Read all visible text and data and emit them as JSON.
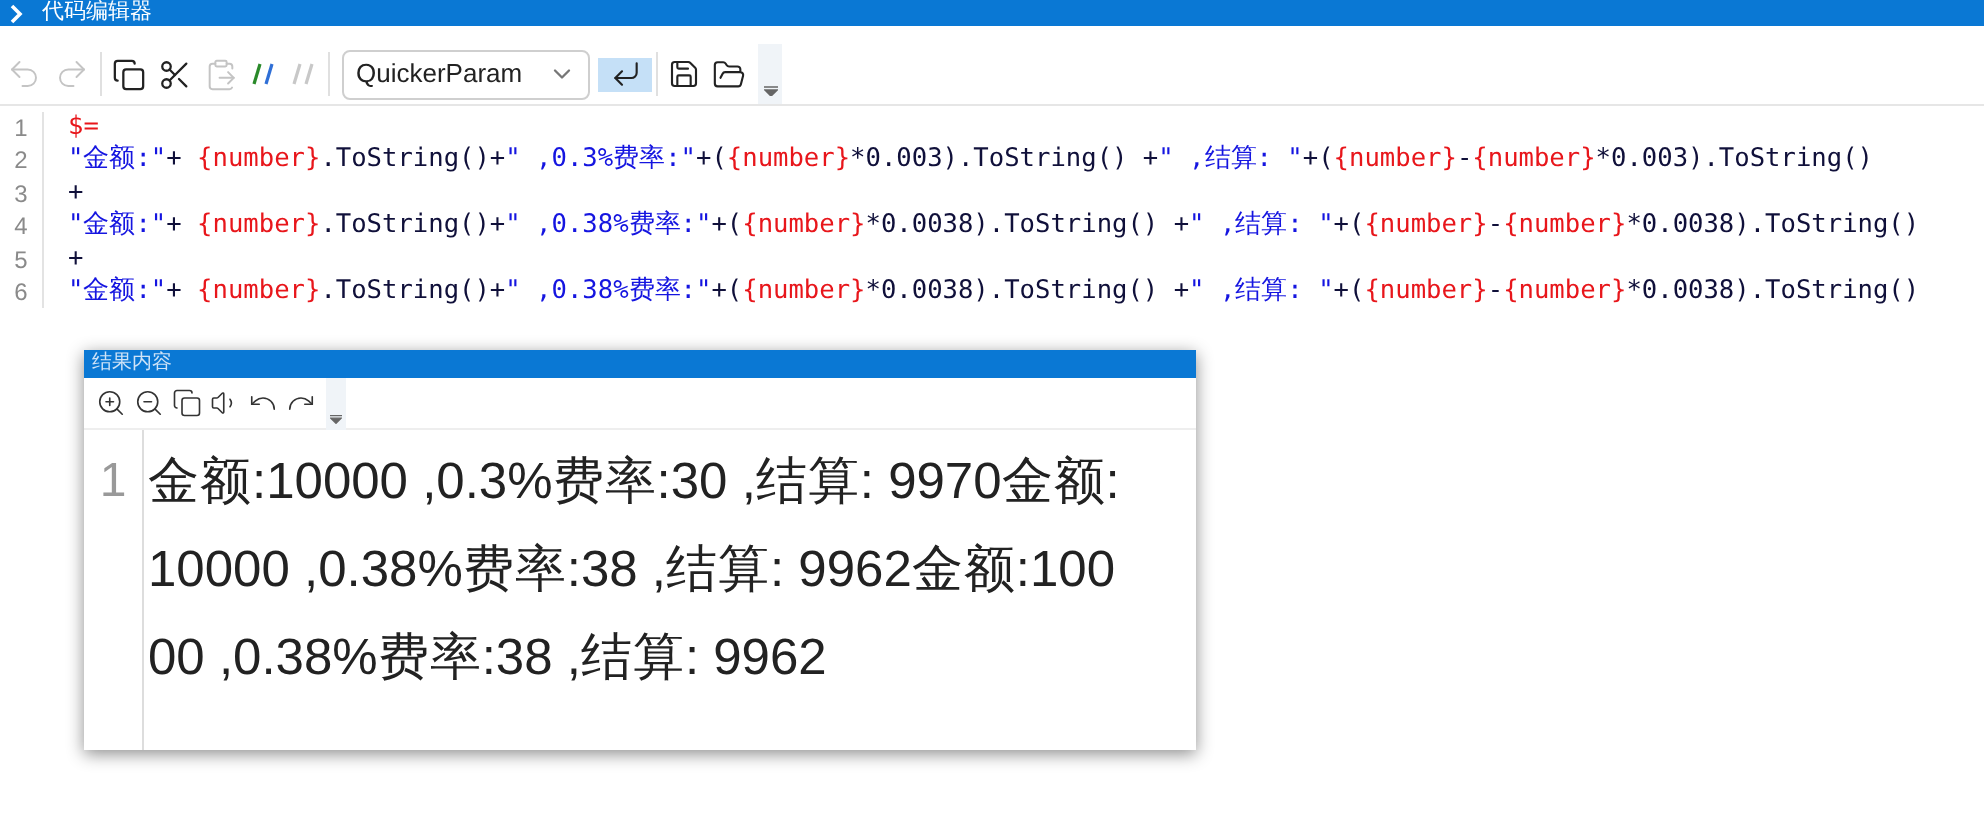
{
  "window": {
    "title": "代码编辑器"
  },
  "toolbar": [
    {
      "kind": "undo",
      "disabled": true
    },
    {
      "kind": "redo",
      "disabled": true
    },
    {
      "kind": "copy",
      "disabled": false
    },
    {
      "kind": "cut",
      "disabled": false
    },
    {
      "kind": "paste",
      "disabled": true
    },
    {
      "kind": "comment",
      "disabled": false
    },
    {
      "kind": "uncomment",
      "disabled": true
    },
    {
      "kind": "select",
      "value": "QuickerParam"
    },
    {
      "kind": "wrap",
      "selected": true
    },
    {
      "kind": "save",
      "disabled": false
    },
    {
      "kind": "open",
      "disabled": false
    }
  ],
  "code_lines": [
    {
      "number": "1",
      "segments": [
        {
          "kind": "var",
          "text": "$="
        }
      ]
    },
    {
      "number": "2",
      "segments": [
        {
          "kind": "string",
          "text": "\"金额:\""
        },
        {
          "kind": "plain",
          "text": "+ "
        },
        {
          "kind": "var",
          "text": "{number}"
        },
        {
          "kind": "plain",
          "text": ".ToString()+"
        },
        {
          "kind": "string",
          "text": "\" ,0.3%费率:\""
        },
        {
          "kind": "plain",
          "text": "+("
        },
        {
          "kind": "var",
          "text": "{number}"
        },
        {
          "kind": "plain",
          "text": "*0.003).ToString() +"
        },
        {
          "kind": "string",
          "text": "\" ,结算: \""
        },
        {
          "kind": "plain",
          "text": "+("
        },
        {
          "kind": "var",
          "text": "{number}"
        },
        {
          "kind": "plain",
          "text": "-"
        },
        {
          "kind": "var",
          "text": "{number}"
        },
        {
          "kind": "plain",
          "text": "*0.003).ToString()"
        }
      ]
    },
    {
      "number": "3",
      "segments": [
        {
          "kind": "plain",
          "text": "+"
        }
      ]
    },
    {
      "number": "4",
      "segments": [
        {
          "kind": "string",
          "text": "\"金额:\""
        },
        {
          "kind": "plain",
          "text": "+ "
        },
        {
          "kind": "var",
          "text": "{number}"
        },
        {
          "kind": "plain",
          "text": ".ToString()+"
        },
        {
          "kind": "string",
          "text": "\" ,0.38%费率:\""
        },
        {
          "kind": "plain",
          "text": "+("
        },
        {
          "kind": "var",
          "text": "{number}"
        },
        {
          "kind": "plain",
          "text": "*0.0038).ToString() +"
        },
        {
          "kind": "string",
          "text": "\" ,结算: \""
        },
        {
          "kind": "plain",
          "text": "+("
        },
        {
          "kind": "var",
          "text": "{number}"
        },
        {
          "kind": "plain",
          "text": "-"
        },
        {
          "kind": "var",
          "text": "{number}"
        },
        {
          "kind": "plain",
          "text": "*0.0038).ToString()"
        }
      ]
    },
    {
      "number": "5",
      "segments": [
        {
          "kind": "plain",
          "text": "+"
        }
      ]
    },
    {
      "number": "6",
      "segments": [
        {
          "kind": "string",
          "text": "\"金额:\""
        },
        {
          "kind": "plain",
          "text": "+ "
        },
        {
          "kind": "var",
          "text": "{number}"
        },
        {
          "kind": "plain",
          "text": ".ToString()+"
        },
        {
          "kind": "string",
          "text": "\" ,0.38%费率:\""
        },
        {
          "kind": "plain",
          "text": "+("
        },
        {
          "kind": "var",
          "text": "{number}"
        },
        {
          "kind": "plain",
          "text": "*0.0038).ToString() +"
        },
        {
          "kind": "string",
          "text": "\" ,结算: \""
        },
        {
          "kind": "plain",
          "text": "+("
        },
        {
          "kind": "var",
          "text": "{number}"
        },
        {
          "kind": "plain",
          "text": "-"
        },
        {
          "kind": "var",
          "text": "{number}"
        },
        {
          "kind": "plain",
          "text": "*0.0038).ToString()"
        }
      ]
    }
  ],
  "result_window": {
    "title": "结果内容",
    "toolbar": [
      {
        "kind": "zoom-in"
      },
      {
        "kind": "zoom-out"
      },
      {
        "kind": "copy"
      },
      {
        "kind": "speak"
      },
      {
        "kind": "undo"
      },
      {
        "kind": "redo"
      }
    ],
    "line_number": "1",
    "text": "金额:10000 ,0.3%费率:30 ,结算: 9970金额:10000 ,0.38%费率:38 ,结算: 9962金额:10000 ,0.38%费率:38 ,结算: 9962"
  }
}
